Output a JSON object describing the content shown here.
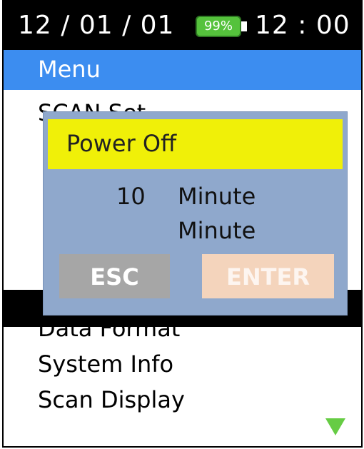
{
  "status": {
    "date": "12 / 01 / 01",
    "battery": "99%",
    "time": "12 : 00"
  },
  "menu": {
    "title": "Menu",
    "items": [
      {
        "label": "SCAN Set"
      },
      {
        "label": ""
      },
      {
        "label": ""
      },
      {
        "label": ""
      },
      {
        "label": ""
      },
      {
        "label": ""
      },
      {
        "label": "Data Format"
      },
      {
        "label": "System Info"
      },
      {
        "label": "Scan Display"
      }
    ]
  },
  "dialog": {
    "title": "Power Off",
    "value": "10",
    "unit": "Minute",
    "unit_secondary": "Minute",
    "esc_label": "ESC",
    "enter_label": "ENTER"
  },
  "colors": {
    "status_bar": "#000000",
    "menu_title": "#3c8df0",
    "battery": "#55c23c",
    "dialog_bg": "#8fa8cc",
    "dialog_title": "#f0f008",
    "esc_button": "#a6a6a6",
    "enter_button": "#f4d4bc",
    "scroll_arrow": "#66cc44"
  },
  "icons": {
    "scroll": "triangle-down-icon"
  }
}
